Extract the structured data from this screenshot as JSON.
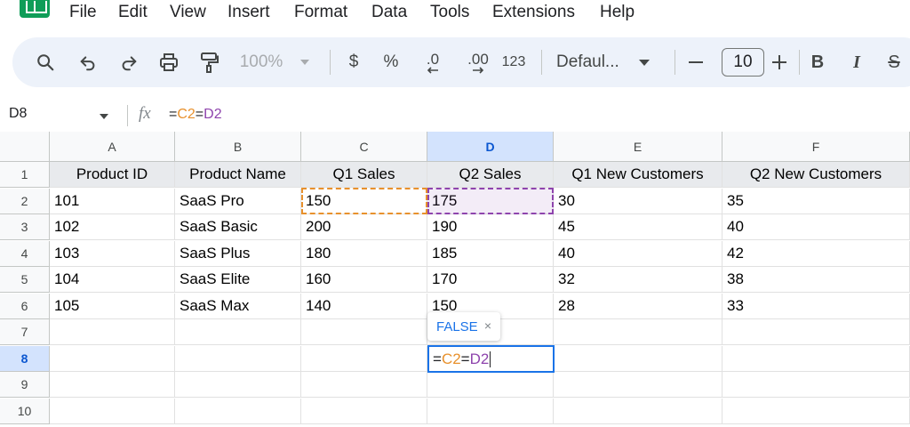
{
  "menu": [
    "File",
    "Edit",
    "View",
    "Insert",
    "Format",
    "Data",
    "Tools",
    "Extensions",
    "Help"
  ],
  "toolbar": {
    "zoom": "100%",
    "currency": "$",
    "percent": "%",
    "decrease_decimal": ".0",
    "increase_decimal": ".00",
    "number_format": "123",
    "font": "Defaul...",
    "font_size": "10",
    "bold": "B",
    "italic": "I",
    "strikethrough": "S"
  },
  "formula_bar": {
    "name_box": "D8",
    "fx": "fx",
    "formula_parts": [
      "=",
      "C2",
      "=",
      "D2"
    ]
  },
  "columns": [
    "A",
    "B",
    "C",
    "D",
    "E",
    "F"
  ],
  "rows": [
    "1",
    "2",
    "3",
    "4",
    "5",
    "6",
    "7",
    "8",
    "9",
    "10"
  ],
  "table": {
    "headers": [
      "Product ID",
      "Product Name",
      "Q1 Sales",
      "Q2 Sales",
      "Q1 New Customers",
      "Q2 New Customers"
    ],
    "rows": [
      [
        "101",
        "SaaS Pro",
        "150",
        "175",
        "30",
        "35"
      ],
      [
        "102",
        "SaaS Basic",
        "200",
        "190",
        "45",
        "40"
      ],
      [
        "103",
        "SaaS Plus",
        "180",
        "185",
        "40",
        "42"
      ],
      [
        "104",
        "SaaS Elite",
        "160",
        "170",
        "32",
        "38"
      ],
      [
        "105",
        "SaaS Max",
        "140",
        "150",
        "28",
        "33"
      ]
    ]
  },
  "active_cell": {
    "ref": "D8",
    "editor_parts": [
      "=",
      "C2",
      "=",
      "D2"
    ],
    "preview": "FALSE",
    "preview_close": "×"
  },
  "colors": {
    "ref_c2": "#e8912d",
    "ref_d2": "#8e44ad",
    "selection": "#1a73e8"
  }
}
